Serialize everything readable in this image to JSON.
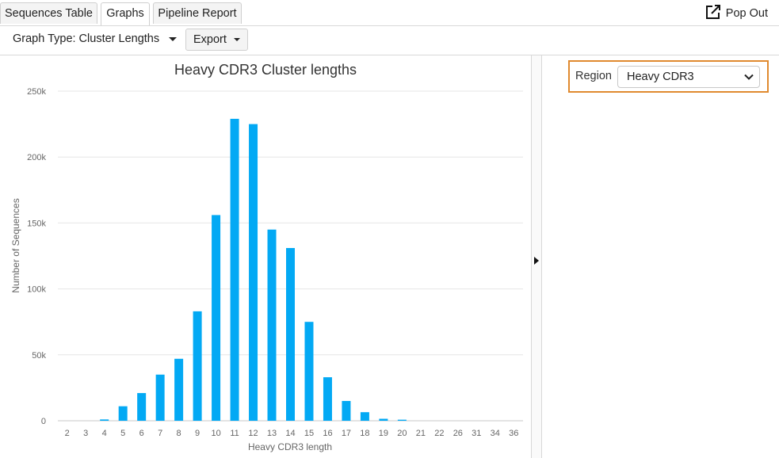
{
  "tabs": [
    {
      "label": "Sequences Table",
      "active": false
    },
    {
      "label": "Graphs",
      "active": true
    },
    {
      "label": "Pipeline Report",
      "active": false
    }
  ],
  "popout_label": "Pop Out",
  "toolbar": {
    "graph_type_label": "Graph Type: Cluster Lengths",
    "export_label": "Export"
  },
  "region": {
    "label": "Region",
    "selected": "Heavy CDR3"
  },
  "colors": {
    "bar": "#03a9f4",
    "highlight": "#e08a2f"
  },
  "chart_data": {
    "type": "bar",
    "title": "Heavy CDR3 Cluster lengths",
    "xlabel": "Heavy CDR3 length",
    "ylabel": "Number of Sequences",
    "ylim": [
      0,
      250000
    ],
    "yticks": [
      0,
      50000,
      100000,
      150000,
      200000,
      250000
    ],
    "ytick_labels": [
      "0",
      "50k",
      "100k",
      "150k",
      "200k",
      "250k"
    ],
    "grid": true,
    "categories": [
      "2",
      "3",
      "4",
      "5",
      "6",
      "7",
      "8",
      "9",
      "10",
      "11",
      "12",
      "13",
      "14",
      "15",
      "16",
      "17",
      "18",
      "19",
      "20",
      "21",
      "22",
      "26",
      "31",
      "34",
      "36"
    ],
    "values": [
      0,
      0,
      1000,
      11000,
      21000,
      35000,
      47000,
      83000,
      156000,
      229000,
      225000,
      145000,
      131000,
      75000,
      33000,
      15000,
      6500,
      1500,
      800,
      0,
      0,
      0,
      0,
      0,
      0
    ]
  }
}
